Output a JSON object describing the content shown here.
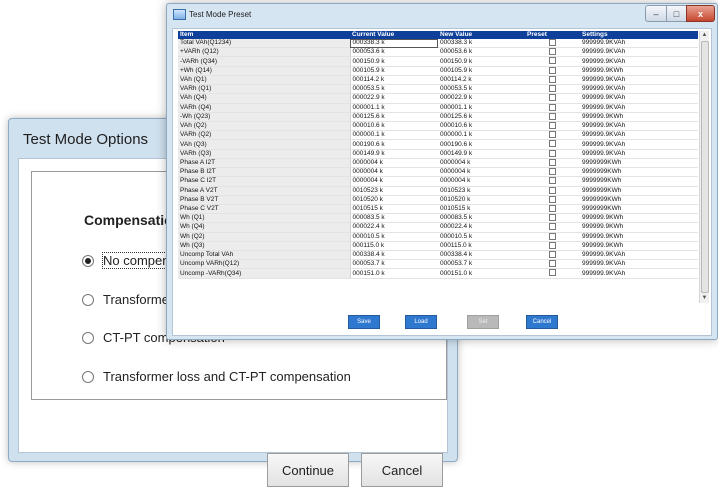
{
  "options_dialog": {
    "title": "Test Mode Options",
    "heading": "Compensation",
    "radios": [
      {
        "label": "No compensation",
        "selected": true
      },
      {
        "label": "Transformer loss compensation",
        "selected": false
      },
      {
        "label": "CT-PT compensation",
        "selected": false
      },
      {
        "label": "Transformer loss and CT-PT compensation",
        "selected": false
      }
    ],
    "continue_label": "Continue",
    "cancel_label": "Cancel"
  },
  "preset_dialog": {
    "title": "Test Mode Preset",
    "controls": {
      "minimize": "–",
      "maximize": "□",
      "close": "x"
    },
    "columns": [
      "Item",
      "Current Value",
      "New Value",
      "Preset",
      "Settings"
    ],
    "rows": [
      [
        "Total VAh(Q1234)",
        "000338.3 k",
        "000338.3 k",
        "999999.9KVAh"
      ],
      [
        "+VARh (Q12)",
        "000053.6 k",
        "000053.6 k",
        "999999.9KVAh"
      ],
      [
        "-VARh (Q34)",
        "000150.9 k",
        "000150.9 k",
        "999999.9KVAh"
      ],
      [
        "+Wh (Q14)",
        "000105.9 k",
        "000105.9 k",
        "999999.9KWh"
      ],
      [
        "VAh (Q1)",
        "000114.2 k",
        "000114.2 k",
        "999999.9KVAh"
      ],
      [
        "VARh (Q1)",
        "000053.5 k",
        "000053.5 k",
        "999999.9KVAh"
      ],
      [
        "VAh (Q4)",
        "000022.9 k",
        "000022.9 k",
        "999999.9KVAh"
      ],
      [
        "VARh (Q4)",
        "000001.1 k",
        "000001.1 k",
        "999999.9KVAh"
      ],
      [
        "-Wh (Q23)",
        "000125.6 k",
        "000125.6 k",
        "999999.9KWh"
      ],
      [
        "VAh (Q2)",
        "000010.6 k",
        "000010.6 k",
        "999999.9KVAh"
      ],
      [
        "VARh (Q2)",
        "000000.1 k",
        "000000.1 k",
        "999999.9KVAh"
      ],
      [
        "VAh (Q3)",
        "000190.6 k",
        "000190.6 k",
        "999999.9KVAh"
      ],
      [
        "VARh (Q3)",
        "000149.9 k",
        "000149.9 k",
        "999999.9KVAh"
      ],
      [
        "Phase A I2T",
        "0000004 k",
        "0000004 k",
        "9999999KWh"
      ],
      [
        "Phase B I2T",
        "0000004 k",
        "0000004 k",
        "9999999KWh"
      ],
      [
        "Phase C I2T",
        "0000004 k",
        "0000004 k",
        "9999999KWh"
      ],
      [
        "Phase A V2T",
        "0010523 k",
        "0010523 k",
        "9999999KWh"
      ],
      [
        "Phase B V2T",
        "0010520 k",
        "0010520 k",
        "9999999KWh"
      ],
      [
        "Phase C V2T",
        "0010515 k",
        "0010515 k",
        "9999999KWh"
      ],
      [
        "Wh (Q1)",
        "000083.5 k",
        "000083.5 k",
        "999999.9KWh"
      ],
      [
        "Wh (Q4)",
        "000022.4 k",
        "000022.4 k",
        "999999.9KWh"
      ],
      [
        "Wh (Q2)",
        "000010.5 k",
        "000010.5 k",
        "999999.9KWh"
      ],
      [
        "Wh (Q3)",
        "000115.0 k",
        "000115.0 k",
        "999999.9KWh"
      ],
      [
        "Uncomp Total VAh",
        "000338.4 k",
        "000338.4 k",
        "999999.9KVAh"
      ],
      [
        "Uncomp VARh(Q12)",
        "000053.7 k",
        "000053.7 k",
        "999999.9KVAh"
      ],
      [
        "Uncomp -VARh(Q34)",
        "000151.0 k",
        "000151.0 k",
        "999999.9KVAh"
      ]
    ],
    "buttons": {
      "save": "Save",
      "load": "Load",
      "set": "Set",
      "cancel": "Cancel"
    }
  }
}
